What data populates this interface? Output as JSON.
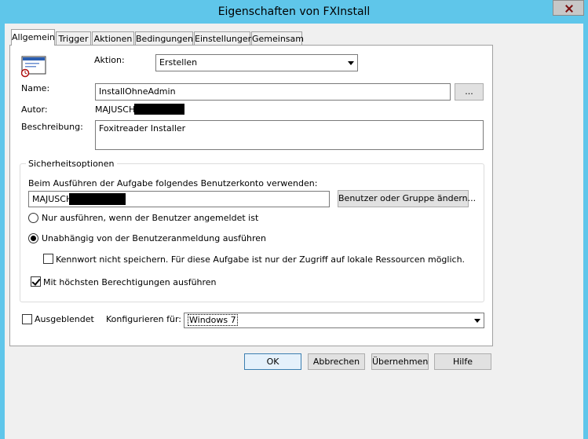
{
  "window": {
    "title": "Eigenschaften von FXInstall"
  },
  "tabs": [
    {
      "label": "Allgemein",
      "active": true
    },
    {
      "label": "Trigger"
    },
    {
      "label": "Aktionen"
    },
    {
      "label": "Bedingungen"
    },
    {
      "label": "Einstellungen"
    },
    {
      "label": "Gemeinsam"
    }
  ],
  "general": {
    "icon": "task-window-icon",
    "action_label": "Aktion:",
    "action_value": "Erstellen",
    "name_label": "Name:",
    "name_value": "InstallOhneAdmin",
    "browse_label": "...",
    "author_label": "Autor:",
    "author_value": "MAJUSCH\\",
    "description_label": "Beschreibung:",
    "description_value": "Foxitreader Installer"
  },
  "security": {
    "legend": "Sicherheitsoptionen",
    "account_prompt": "Beim Ausführen der Aufgabe folgendes Benutzerkonto verwenden:",
    "account_value": "MAJUSCH\\",
    "change_button": "Benutzer oder Gruppe ändern...",
    "radio_logged_on": "Nur ausführen, wenn der Benutzer angemeldet ist",
    "radio_independent": "Unabhängig von der Benutzeranmeldung ausführen",
    "no_password": "Kennwort nicht speichern. Für diese Aufgabe ist nur der Zugriff auf lokale Ressourcen möglich.",
    "highest_privileges": "Mit höchsten Berechtigungen ausführen",
    "selected_radio": "independent",
    "highest_privileges_checked": true,
    "no_password_checked": false
  },
  "bottom": {
    "hidden_label": "Ausgeblendet",
    "hidden_checked": false,
    "configure_label": "Konfigurieren für:",
    "configure_value": "Windows 7"
  },
  "buttons": {
    "ok": "OK",
    "cancel": "Abbrechen",
    "apply": "Übernehmen",
    "help": "Hilfe"
  }
}
